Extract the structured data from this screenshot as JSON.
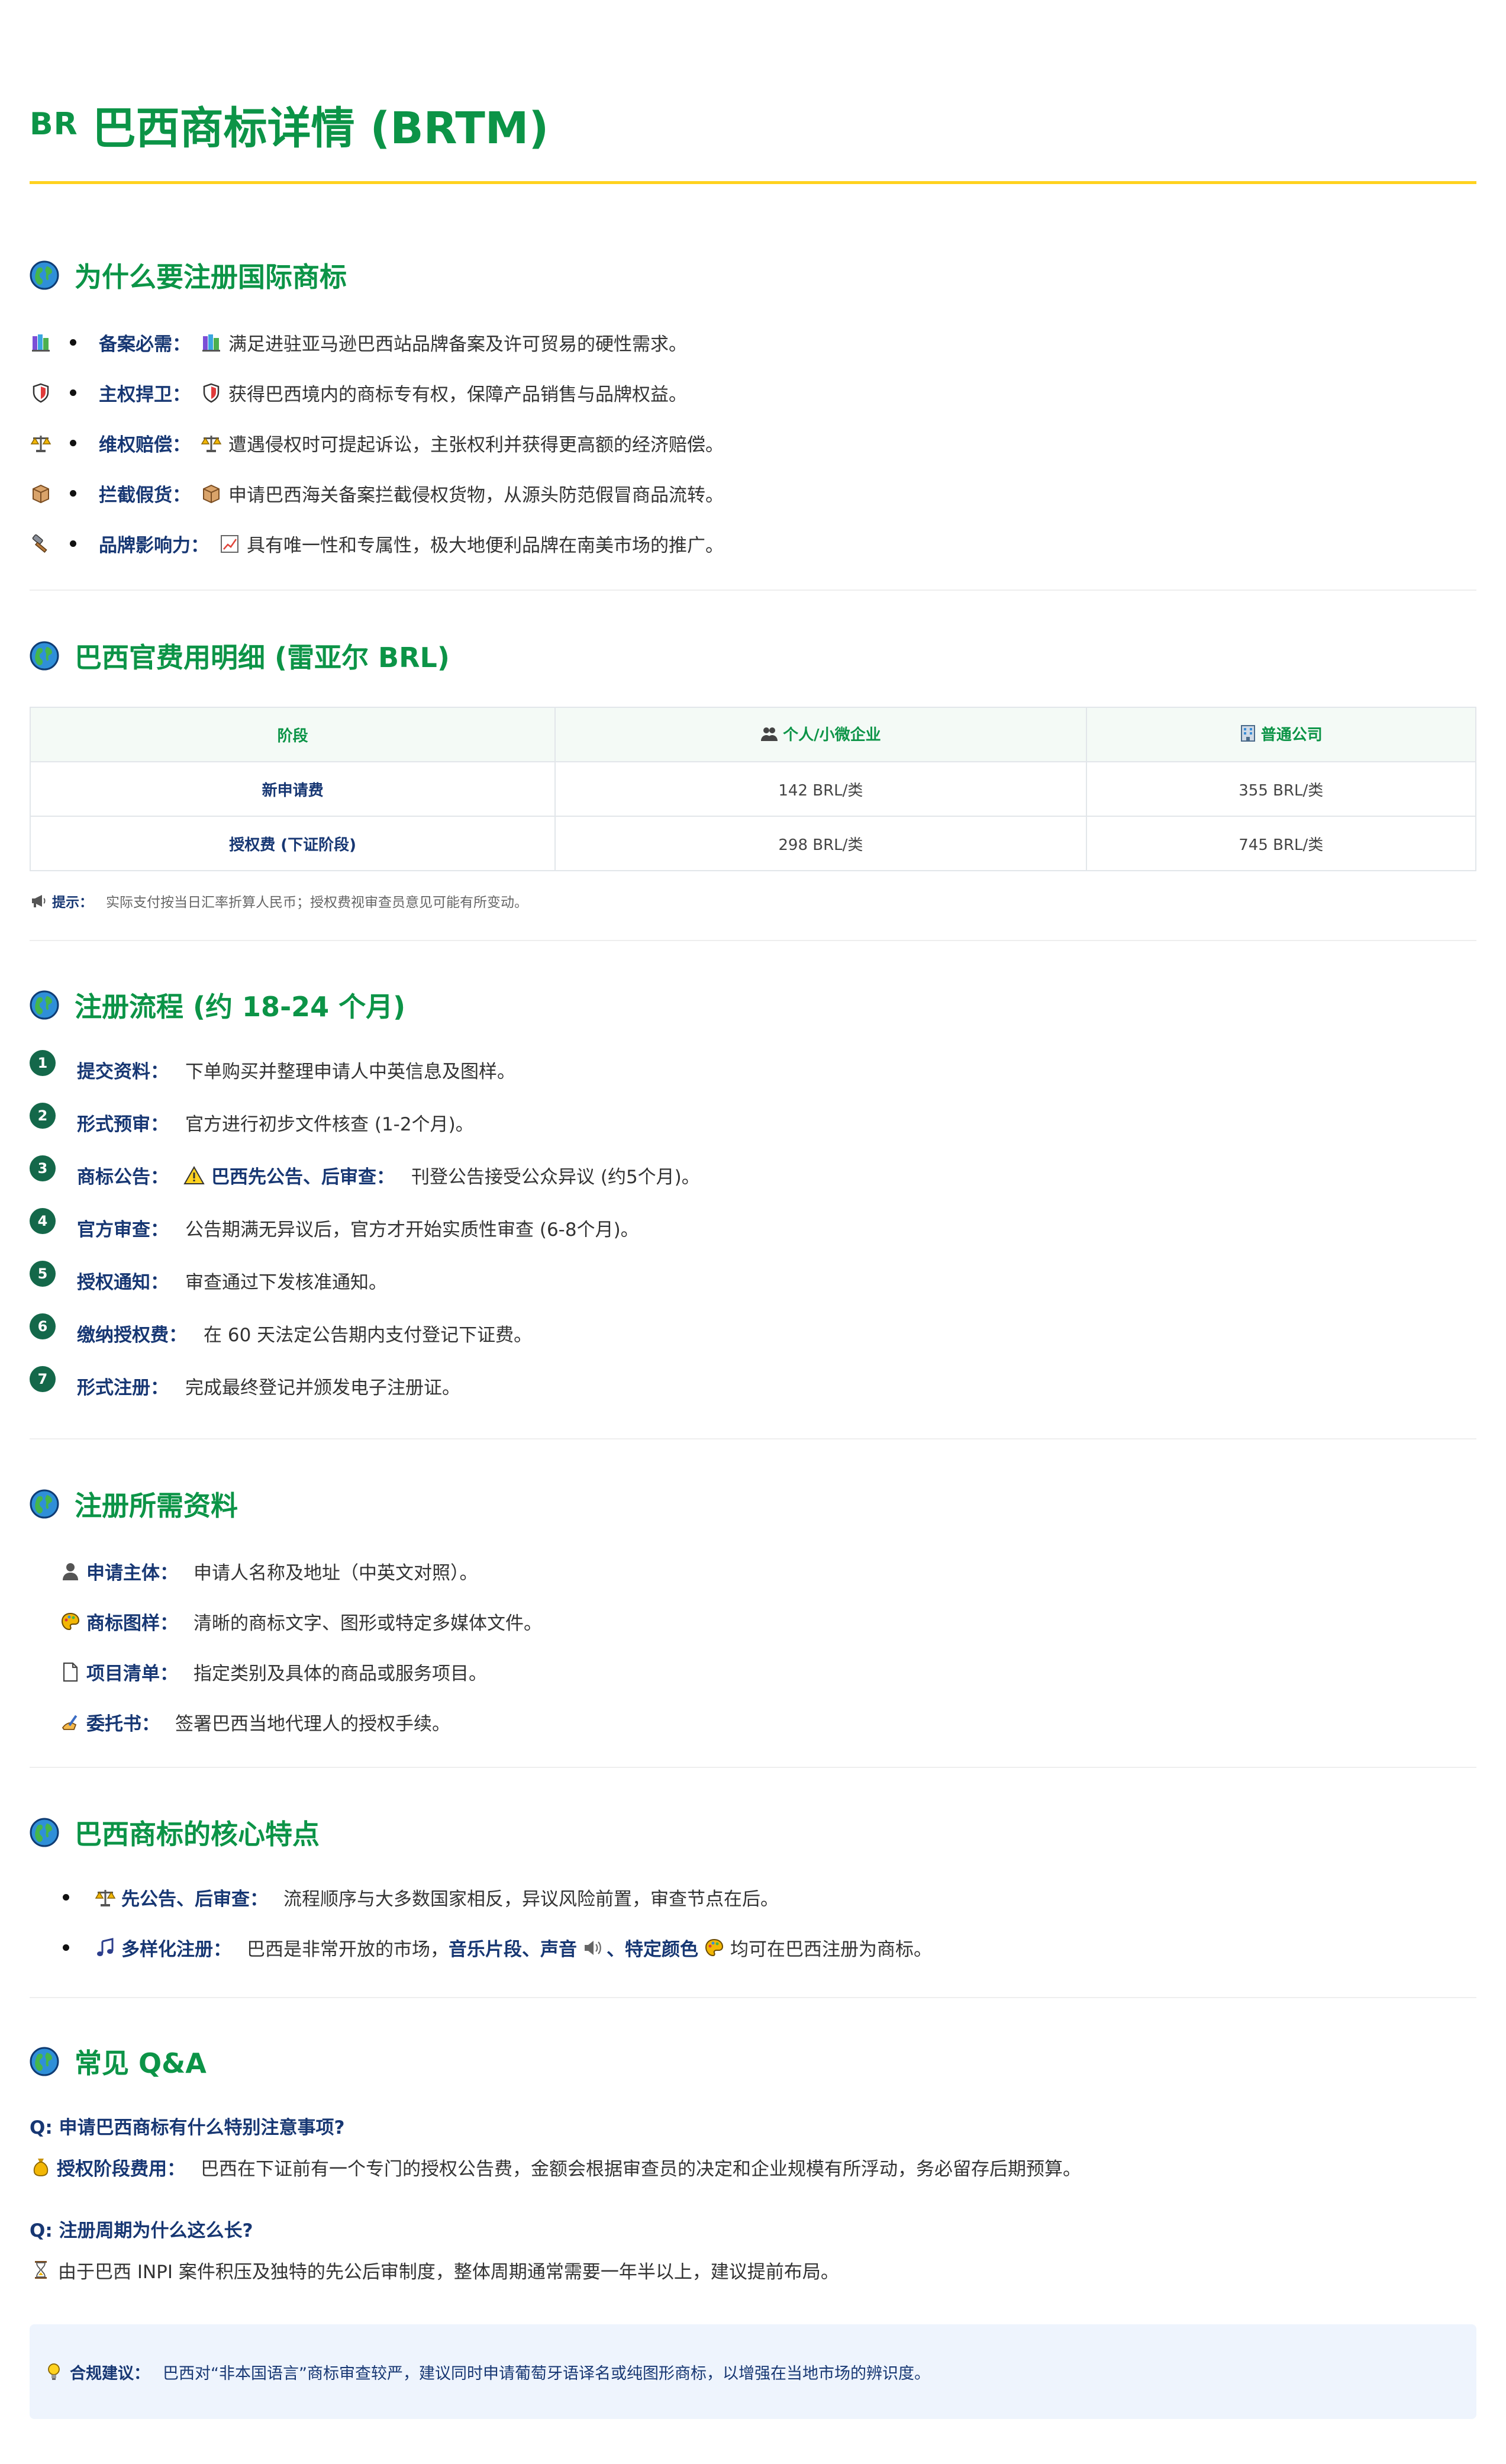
{
  "header": {
    "flag": "BR",
    "title": "巴西商标详情 (BRTM)"
  },
  "why": {
    "title": "为什么要注册国际商标",
    "items": [
      {
        "icon": "books-icon",
        "label": "备案必需：",
        "icon2": "books-icon",
        "text": "满足进驻亚马逊巴西站品牌备案及许可贸易的硬性需求。"
      },
      {
        "icon": "shield-icon",
        "label": "主权捍卫：",
        "icon2": "shield-icon",
        "text": "获得巴西境内的商标专有权，保障产品销售与品牌权益。"
      },
      {
        "icon": "scales-icon",
        "label": "维权赔偿：",
        "icon2": "scales-icon",
        "text": "遭遇侵权时可提起诉讼，主张权利并获得更高额的经济赔偿。"
      },
      {
        "icon": "package-icon",
        "label": "拦截假货：",
        "icon2": "package-icon",
        "text": "申请巴西海关备案拦截侵权货物，从源头防范假冒商品流转。"
      },
      {
        "icon": "hammer-icon",
        "label": "品牌影响力：",
        "icon2": "chart-icon",
        "text": "具有唯一性和专属性，极大地便利品牌在南美市场的推广。"
      }
    ]
  },
  "fees": {
    "title": "巴西官费用明细 (雷亚尔 BRL)",
    "headers": [
      "阶段",
      "个人/小微企业",
      "普通公司"
    ],
    "rows": [
      [
        "新申请费",
        "142 BRL/类",
        "355 BRL/类"
      ],
      [
        "授权费 (下证阶段)",
        "298 BRL/类",
        "745 BRL/类"
      ]
    ],
    "tip_label": "提示：",
    "tip_text": "实际支付按当日汇率折算人民币；授权费视审查员意见可能有所变动。"
  },
  "process": {
    "title": "注册流程 (约 18-24 个月)",
    "steps": [
      {
        "n": "1",
        "label": "提交资料：",
        "text": "下单购买并整理申请人中英信息及图样。"
      },
      {
        "n": "2",
        "label": "形式预审：",
        "text": "官方进行初步文件核查 (1-2个月)。"
      },
      {
        "n": "3",
        "label": "商标公告：",
        "highlight": "巴西先公告、后审查：",
        "text": "刊登公告接受公众异议 (约5个月)。"
      },
      {
        "n": "4",
        "label": "官方审查：",
        "text": "公告期满无异议后，官方才开始实质性审查 (6-8个月)。"
      },
      {
        "n": "5",
        "label": "授权通知：",
        "text": "审查通过下发核准通知。"
      },
      {
        "n": "6",
        "label": "缴纳授权费：",
        "text": "在 60 天法定公告期内支付登记下证费。"
      },
      {
        "n": "7",
        "label": "形式注册：",
        "text": "完成最终登记并颁发电子注册证。"
      }
    ]
  },
  "materials": {
    "title": "注册所需资料",
    "items": [
      {
        "icon": "person-icon",
        "label": "申请主体：",
        "text": "申请人名称及地址（中英文对照）。"
      },
      {
        "icon": "palette-icon",
        "label": "商标图样：",
        "text": "清晰的商标文字、图形或特定多媒体文件。"
      },
      {
        "icon": "document-icon",
        "label": "项目清单：",
        "text": "指定类别及具体的商品或服务项目。"
      },
      {
        "icon": "writing-hand-icon",
        "label": "委托书：",
        "text": "签署巴西当地代理人的授权手续。"
      }
    ]
  },
  "features": {
    "title": "巴西商标的核心特点",
    "item1": {
      "label": "先公告、后审查：",
      "text": "流程顺序与大多数国家相反，异议风险前置，审查节点在后。"
    },
    "item2": {
      "label": "多样化注册：",
      "pre": "巴西是非常开放的市场，",
      "h1": "音乐片段",
      "sep": "、",
      "h2": "声音",
      "sep2": "、",
      "h3": "特定颜色",
      "post": "均可在巴西注册为商标。"
    }
  },
  "faq": {
    "title": "常见 Q&A",
    "q1": "Q: 申请巴西商标有什么特别注意事项?",
    "a1_label": "授权阶段费用：",
    "a1_text": "巴西在下证前有一个专门的授权公告费，金额会根据审查员的决定和企业规模有所浮动，务必留存后期预算。",
    "q2": "Q: 注册周期为什么这么长?",
    "a2_text": "由于巴西 INPI 案件积压及独特的先公后审制度，整体周期通常需要一年半以上，建议提前布局。"
  },
  "note": {
    "label": "合规建议：",
    "text": "巴西对“非本国语言”商标审查较严，建议同时申请葡萄牙语译名或纯图形商标，以增强在当地市场的辨识度。"
  },
  "colors": {
    "brand_green": "#0c9447",
    "accent_yellow": "#ffd21f",
    "label_navy": "#173773",
    "step_green": "#14684a"
  }
}
